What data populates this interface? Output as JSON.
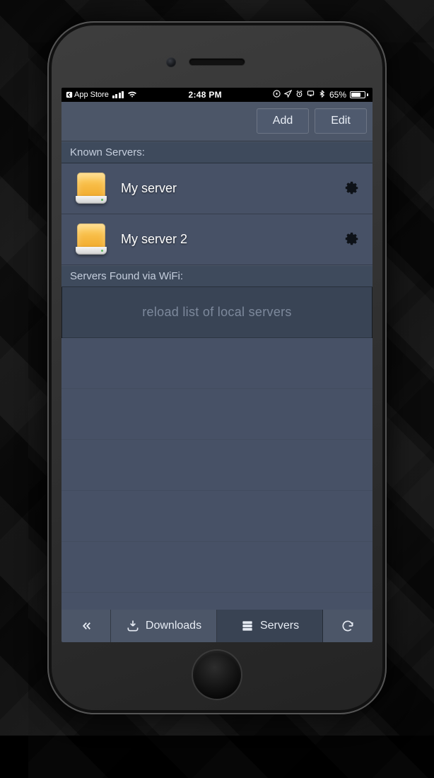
{
  "statusbar": {
    "back_label": "App Store",
    "time": "2:48 PM",
    "battery_text": "65%"
  },
  "topbar": {
    "add_label": "Add",
    "edit_label": "Edit"
  },
  "sections": {
    "known_header": "Known Servers:",
    "wifi_header": "Servers Found via WiFi:",
    "reload_label": "reload list of local servers"
  },
  "servers": [
    {
      "name": "My server"
    },
    {
      "name": "My server 2"
    }
  ],
  "tabs": {
    "downloads_label": "Downloads",
    "servers_label": "Servers"
  }
}
